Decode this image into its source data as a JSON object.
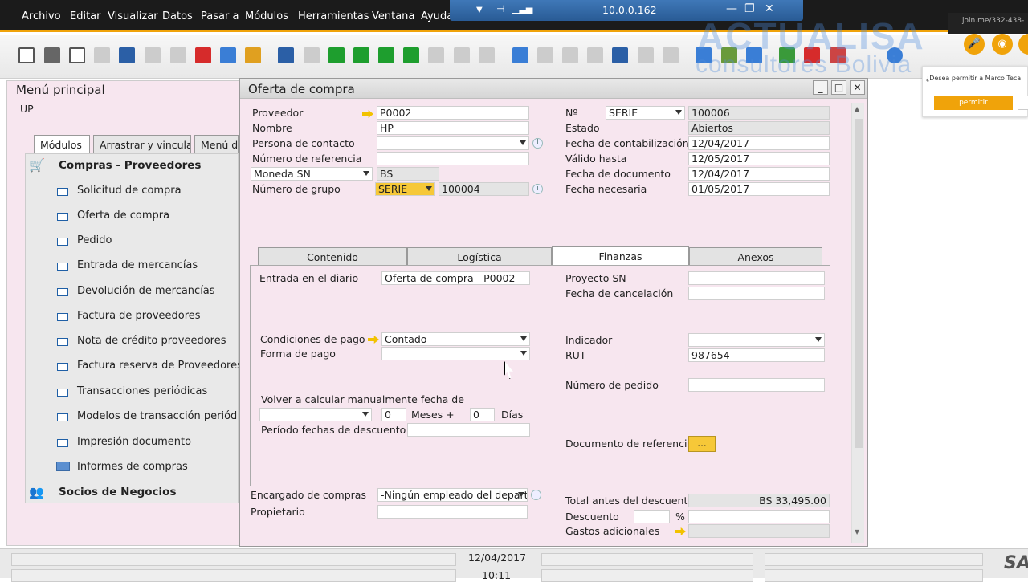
{
  "menubar": [
    "Archivo",
    "Editar",
    "Visualizar",
    "Datos",
    "Pasar a",
    "Módulos",
    "Herramientas",
    "Ventana",
    "Ayuda"
  ],
  "remote": {
    "ip": "10.0.0.162"
  },
  "watermark": {
    "line1": "ACTUALISA",
    "line2": "consultores Bolivia"
  },
  "notification": {
    "join": "join.me/332-438-",
    "question": "¿Desea permitir a Marco Teca",
    "allow": "permitir"
  },
  "main_menu": {
    "title": "Menú principal",
    "user": "UP",
    "tabs": [
      "Módulos",
      "Arrastrar y vincular",
      "Menú d"
    ],
    "section": "Compras - Proveedores",
    "items": [
      "Solicitud de compra",
      "Oferta de compra",
      "Pedido",
      "Entrada de mercancías",
      "Devolución de mercancías",
      "Factura de proveedores",
      "Nota de crédito proveedores",
      "Factura reserva de Proveedores",
      "Transacciones periódicas",
      "Modelos de transacción periódic",
      "Impresión documento",
      "Informes de compras"
    ],
    "section2": "Socios de Negocios"
  },
  "window": {
    "title": "Oferta de compra",
    "left": {
      "proveedor_lbl": "Proveedor",
      "proveedor": "P0002",
      "nombre_lbl": "Nombre",
      "nombre": "HP",
      "contacto_lbl": "Persona de contacto",
      "contacto": "",
      "referencia_lbl": "Número de referencia d",
      "referencia": "",
      "moneda_lbl": "Moneda SN",
      "moneda": "BS",
      "grupo_lbl": "Número de grupo",
      "grupo_serie": "SERIE",
      "grupo": "100004"
    },
    "right": {
      "no_lbl": "Nº",
      "serie": "SERIE",
      "numero": "100006",
      "estado_lbl": "Estado",
      "estado": "Abiertos",
      "fcont_lbl": "Fecha de contabilización",
      "fcont": "12/04/2017",
      "valido_lbl": "Válido hasta",
      "valido": "12/05/2017",
      "fdoc_lbl": "Fecha de documento",
      "fdoc": "12/04/2017",
      "fnec_lbl": "Fecha necesaria",
      "fnec": "01/05/2017"
    },
    "tabs": [
      "Contenido",
      "Logística",
      "Finanzas",
      "Anexos"
    ],
    "finanzas": {
      "entrada_lbl": "Entrada en el diario",
      "entrada": "Oferta de compra - P0002",
      "condiciones_lbl": "Condiciones de pago",
      "condiciones": "Contado",
      "forma_lbl": "Forma de pago",
      "forma": "",
      "volver_lbl": "Volver a calcular manualmente fecha de",
      "meses_val": "0",
      "meses_lbl": "Meses +",
      "dias_val": "0",
      "dias_lbl": "Días",
      "periodo_lbl": "Período fechas de descuento p",
      "proyecto_lbl": "Proyecto SN",
      "proyecto": "",
      "cancel_lbl": "Fecha de cancelación",
      "cancel": "",
      "indicador_lbl": "Indicador",
      "indicador": "",
      "rut_lbl": "RUT",
      "rut": "987654",
      "pedido_lbl": "Número de pedido",
      "pedido": "",
      "docref_lbl": "Documento de referencia",
      "docref_btn": "..."
    },
    "footer": {
      "encargado_lbl": "Encargado de compras",
      "encargado": "-Ningún empleado del depart",
      "propietario_lbl": "Propietario",
      "propietario": "",
      "total_lbl": "Total antes del descuento",
      "total": "BS 33,495.00",
      "descuento_lbl": "Descuento",
      "pct": "%",
      "gastos_lbl": "Gastos adicionales"
    }
  },
  "statusbar": {
    "date": "12/04/2017",
    "time": "10:11",
    "brand": "SA"
  }
}
